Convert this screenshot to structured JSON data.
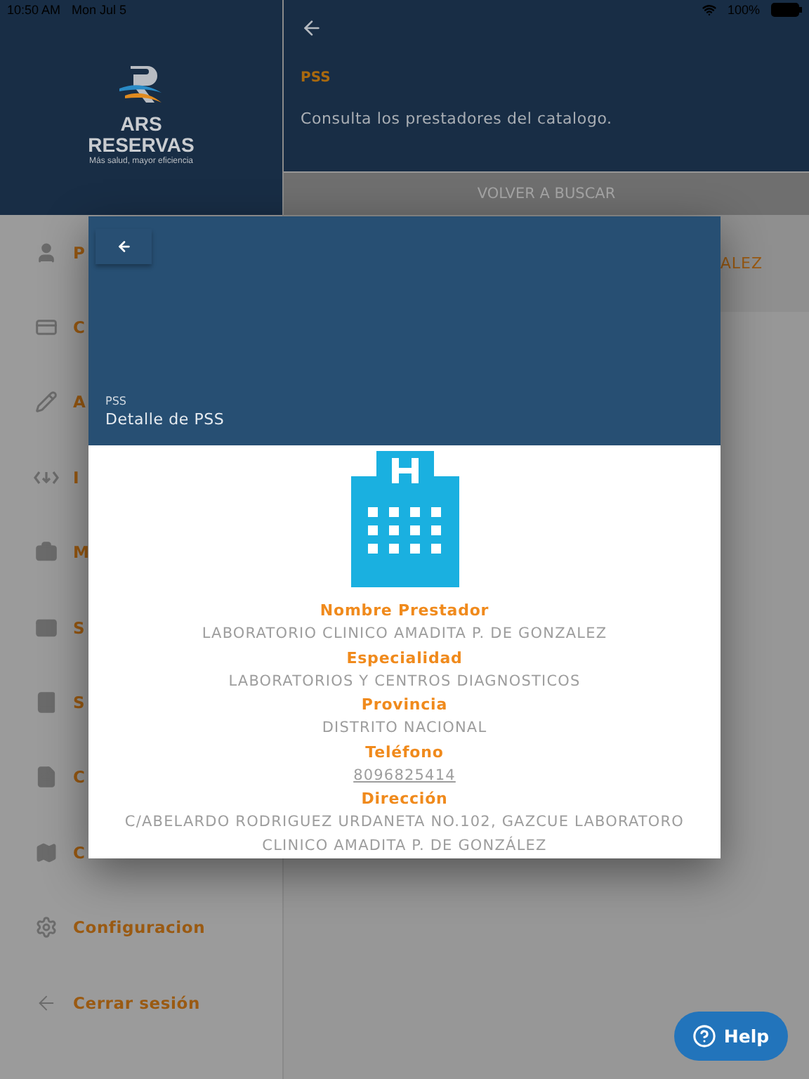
{
  "status_bar": {
    "time": "10:50 AM",
    "date": "Mon Jul 5",
    "battery": "100%"
  },
  "sidebar": {
    "logo": {
      "line1": "ARS",
      "line2": "RESERVAS",
      "tagline": "Más salud, mayor eficiencia"
    },
    "items": [
      {
        "kind": "person",
        "label": "P"
      },
      {
        "kind": "card",
        "label": "C"
      },
      {
        "kind": "pencil",
        "label": "A"
      },
      {
        "kind": "code",
        "label": "I"
      },
      {
        "kind": "medkit",
        "label": "M"
      },
      {
        "kind": "mail",
        "label": "S"
      },
      {
        "kind": "book",
        "label": "S"
      },
      {
        "kind": "doc",
        "label": "C"
      },
      {
        "kind": "map",
        "label": "C"
      },
      {
        "kind": "gear",
        "label": "Configuracion"
      },
      {
        "kind": "logout",
        "label": "Cerrar sesión"
      }
    ]
  },
  "main": {
    "section": "PSS",
    "description": "Consulta los prestadores del catalogo.",
    "search_again": "VOLVER A BUSCAR",
    "result_fragment": "ALEZ"
  },
  "dialog": {
    "overline": "PSS",
    "title": "Detalle de PSS",
    "fields": [
      {
        "label": "Nombre Prestador",
        "value": "LABORATORIO CLINICO AMADITA P. DE GONZALEZ",
        "kind": "text"
      },
      {
        "label": "Especialidad",
        "value": "LABORATORIOS Y CENTROS DIAGNOSTICOS",
        "kind": "text"
      },
      {
        "label": "Provincia",
        "value": "DISTRITO NACIONAL",
        "kind": "text"
      },
      {
        "label": "Teléfono",
        "value": "8096825414",
        "kind": "link"
      },
      {
        "label": "Dirección",
        "value": "C/ABELARDO RODRIGUEZ URDANETA NO.102, GAZCUE LABORATORO CLINICO AMADITA P. DE GONZÁLEZ",
        "kind": "text"
      }
    ]
  },
  "help_button": "Help"
}
